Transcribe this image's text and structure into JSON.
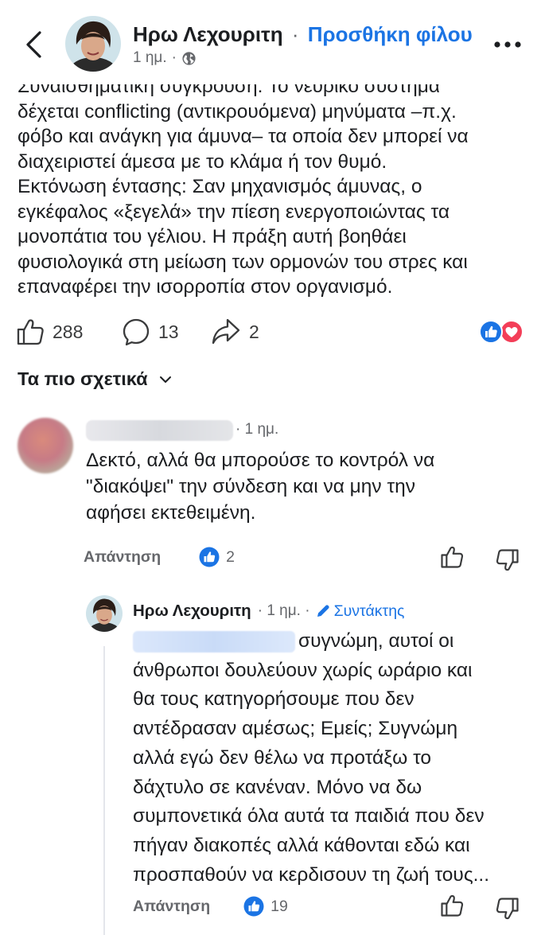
{
  "header": {
    "author_name": "Ηρω Λεχουριτη",
    "separator": "·",
    "add_friend_label": "Προσθήκη φίλου",
    "time": "1 ημ.",
    "meta_separator": "·",
    "audience_icon": "globe-icon",
    "back_icon": "chevron-left-icon",
    "more_icon": "more-dots-icon"
  },
  "post": {
    "lines": [
      "Συναισθηματική σύγκρουση: Το νευρικό σύστημα",
      "δέχεται conflicting (αντικρουόμενα) μηνύματα –π.χ.",
      "φόβο και ανάγκη για άμυνα– τα οποία δεν μπορεί να",
      "διαχειριστεί άμεσα με το κλάμα ή τον θυμό.",
      "Εκτόνωση έντασης: Σαν μηχανισμός άμυνας, ο",
      "εγκέφαλος «ξεγελά» την πίεση ενεργοποιώντας τα",
      "μονοπάτια του γέλιου. Η πράξη αυτή βοηθάει",
      "φυσιολογικά στη μείωση των ορμονών του στρες και",
      "επαναφέρει την ισορροπία στον οργανισμό."
    ]
  },
  "reactions": {
    "likes": "288",
    "comments": "13",
    "shares": "2",
    "like_icon": "thumbs-up-icon",
    "comment_icon": "comment-bubble-icon",
    "share_icon": "share-arrow-icon",
    "summary_icons": [
      "like-reaction-icon",
      "love-reaction-icon"
    ]
  },
  "comments_section": {
    "filter_label": "Τα πιο σχετικά",
    "filter_icon": "chevron-down-icon"
  },
  "comment1": {
    "time_prefix": "·",
    "time": "1 ημ.",
    "text_lines": [
      "Δεκτό, αλλά θα μπορούσε το κοντρόλ να",
      "\"διακόψει\" την σύνδεση και να μην την",
      "αφήσει εκτεθειμένη."
    ],
    "reply_label": "Απάντηση",
    "like_count": "2"
  },
  "reply1": {
    "author_name": "Ηρω Λεχουριτη",
    "time": "· 1 ημ. ·",
    "badge_label": "Συντάκτης",
    "text_lines": [
      "συγνώμη, αυτοί οι",
      "άνθρωποι δουλεύουν χωρίς ωράριο και",
      "θα τους κατηγορήσουμε που δεν",
      "αντέδρασαν αμέσως; Εμείς; Συγνώμη",
      "αλλά εγώ δεν θέλω να προτάξω το",
      "δάχτυλο σε κανέναν. Μόνο να δω",
      "συμπονετικά όλα αυτά τα παιδιά που δεν",
      "πήγαν διακοπές αλλά κάθονται εδώ και",
      "προσπαθούν να κερδισουν τη ζωή τους..."
    ],
    "reply_label": "Απάντηση",
    "like_count": "19"
  },
  "colors": {
    "accent_blue": "#1b74e4",
    "love_red": "#f33e58",
    "secondary_text": "#65676b"
  }
}
